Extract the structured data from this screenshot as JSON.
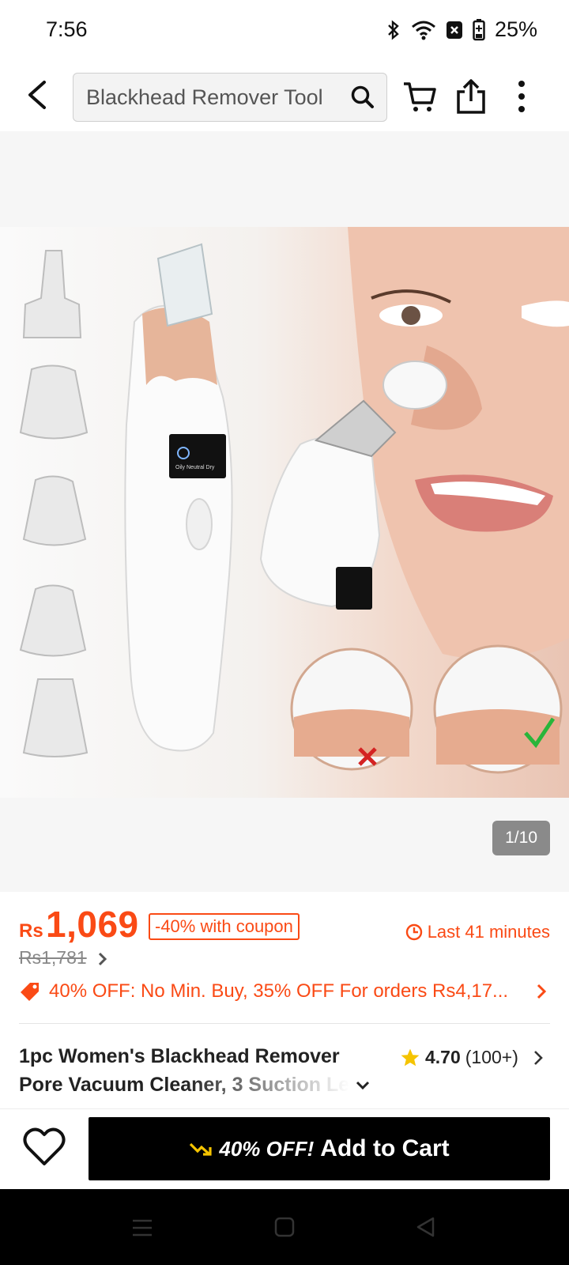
{
  "status": {
    "time": "7:56",
    "battery": "25%"
  },
  "search": {
    "placeholder": "Blackhead Remover Tool"
  },
  "gallery": {
    "counter": "1/10",
    "device_screen_text": "Oily  Neutral  Dry"
  },
  "price": {
    "currency": "Rs",
    "current": "1,069",
    "coupon": "-40% with coupon",
    "original": "Rs1,781",
    "timer": "Last 41 minutes"
  },
  "promo": {
    "text": "40% OFF: No Min. Buy,  35% OFF For orders Rs4,17..."
  },
  "product": {
    "title_line1": "1pc Women's Blackhead Remover",
    "title_line2": "Pore Vacuum Cleaner, 3 Suction Le",
    "rating": "4.70",
    "reviews": "(100+)"
  },
  "actions": {
    "discount": "40% OFF!",
    "add_to_cart": "Add to Cart"
  },
  "colors": {
    "accent": "#fa4a15",
    "star": "#f5c400"
  }
}
